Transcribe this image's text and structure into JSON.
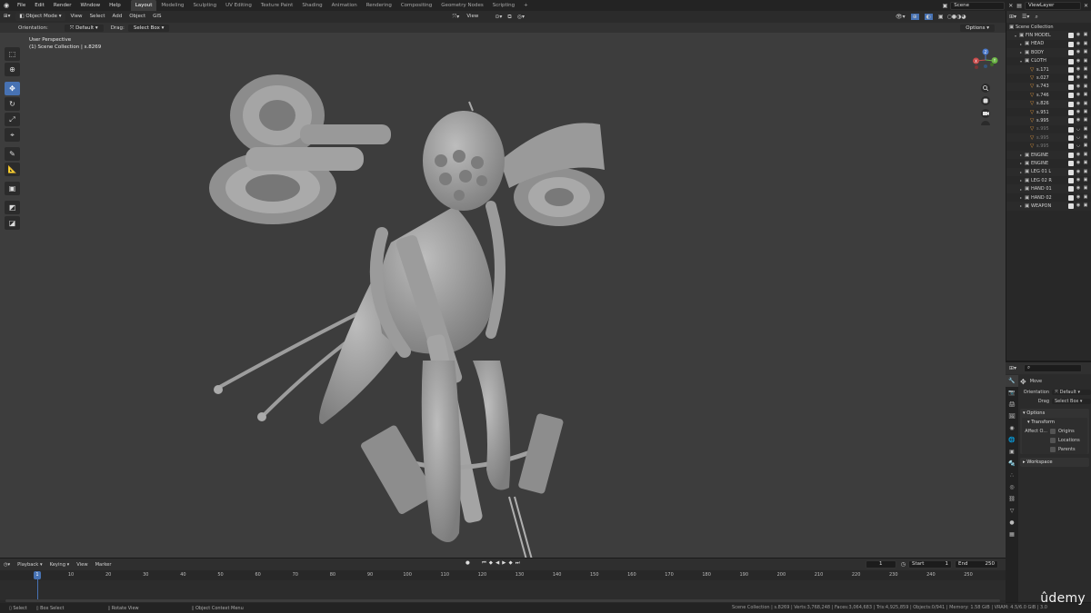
{
  "topbar": {
    "menu": [
      "File",
      "Edit",
      "Render",
      "Window",
      "Help"
    ],
    "workspaces": [
      "Layout",
      "Modeling",
      "Sculpting",
      "UV Editing",
      "Texture Paint",
      "Shading",
      "Animation",
      "Rendering",
      "Compositing",
      "Geometry Nodes",
      "Scripting"
    ],
    "active_workspace": "Layout",
    "add_tab": "+",
    "scene": "Scene",
    "view_layer": "ViewLayer"
  },
  "viewport": {
    "mode": "Object Mode",
    "menu": [
      "View",
      "Select",
      "Add",
      "Object",
      "GIS"
    ],
    "orientation_label": "Orientation:",
    "orientation_value": "Default",
    "drag_label": "Drag:",
    "drag_value": "Select Box",
    "view_dropdown": "View",
    "options_label": "Options",
    "perspective": "User Perspective",
    "collection_info": "(1) Scene Collection | s.8269",
    "gizmo": {
      "x": "X",
      "y": "Y",
      "z": "Z"
    }
  },
  "outliner": {
    "root": "Scene Collection",
    "items": [
      {
        "name": "FIN MODEL",
        "level": 1,
        "type": "collection",
        "dim": false
      },
      {
        "name": "HEAD",
        "level": 2,
        "type": "collection",
        "dim": false
      },
      {
        "name": "BODY",
        "level": 2,
        "type": "collection",
        "dim": false
      },
      {
        "name": "CLOTH",
        "level": 2,
        "type": "collection",
        "dim": false
      },
      {
        "name": "s.171",
        "level": 3,
        "type": "mesh",
        "dim": false
      },
      {
        "name": "s.027",
        "level": 3,
        "type": "mesh",
        "dim": false
      },
      {
        "name": "s.743",
        "level": 3,
        "type": "mesh",
        "dim": false
      },
      {
        "name": "s.746",
        "level": 3,
        "type": "mesh",
        "dim": false
      },
      {
        "name": "s.826",
        "level": 3,
        "type": "mesh",
        "dim": false
      },
      {
        "name": "s.951",
        "level": 3,
        "type": "mesh",
        "dim": false
      },
      {
        "name": "s.995",
        "level": 3,
        "type": "mesh",
        "dim": false
      },
      {
        "name": "s.995",
        "level": 3,
        "type": "mesh",
        "dim": true
      },
      {
        "name": "s.995",
        "level": 3,
        "type": "mesh",
        "dim": true
      },
      {
        "name": "s.995",
        "level": 3,
        "type": "mesh",
        "dim": true
      },
      {
        "name": "ENGINE",
        "level": 2,
        "type": "collection",
        "dim": false
      },
      {
        "name": "ENGINE",
        "level": 2,
        "type": "collection",
        "dim": false
      },
      {
        "name": "LEG 01 L",
        "level": 2,
        "type": "collection",
        "dim": false
      },
      {
        "name": "LEG 02 R",
        "level": 2,
        "type": "collection",
        "dim": false
      },
      {
        "name": "HAND 01",
        "level": 2,
        "type": "collection",
        "dim": false
      },
      {
        "name": "HAND 02",
        "level": 2,
        "type": "collection",
        "dim": false
      },
      {
        "name": "WEAPON",
        "level": 2,
        "type": "collection",
        "dim": false
      }
    ]
  },
  "properties": {
    "tool_name": "Move",
    "orientation_label": "Orientation",
    "orientation_value": "Default",
    "drag_label": "Drag",
    "drag_value": "Select Box",
    "options_panel": "Options",
    "transform_panel": "Transform",
    "affect_label": "Affect O...",
    "affect_options": [
      "Origins",
      "Locations",
      "Parents"
    ],
    "workspace_panel": "Workspace"
  },
  "timeline": {
    "menu": [
      "Playback",
      "Keying",
      "View",
      "Marker"
    ],
    "current_frame": "1",
    "start_label": "Start",
    "start_value": "1",
    "end_label": "End",
    "end_value": "250",
    "ticks": [
      "10",
      "20",
      "30",
      "40",
      "50",
      "60",
      "70",
      "80",
      "90",
      "100",
      "110",
      "120",
      "130",
      "140",
      "150",
      "160",
      "170",
      "180",
      "190",
      "200",
      "210",
      "220",
      "230",
      "240",
      "250"
    ]
  },
  "status": {
    "select": "Select",
    "box_select": "Box Select",
    "rotate_view": "Rotate View",
    "context_menu": "Object Context Menu",
    "stats": "Scene Collection | s.8269 | Verts:3,768,248 | Faces:3,064,683 | Tris:4,925,859 | Objects:0/941 | Memory: 1.58 GiB | VRAM: 4.5/6.0 GiB | 3.0"
  },
  "watermark": "ûdemy"
}
